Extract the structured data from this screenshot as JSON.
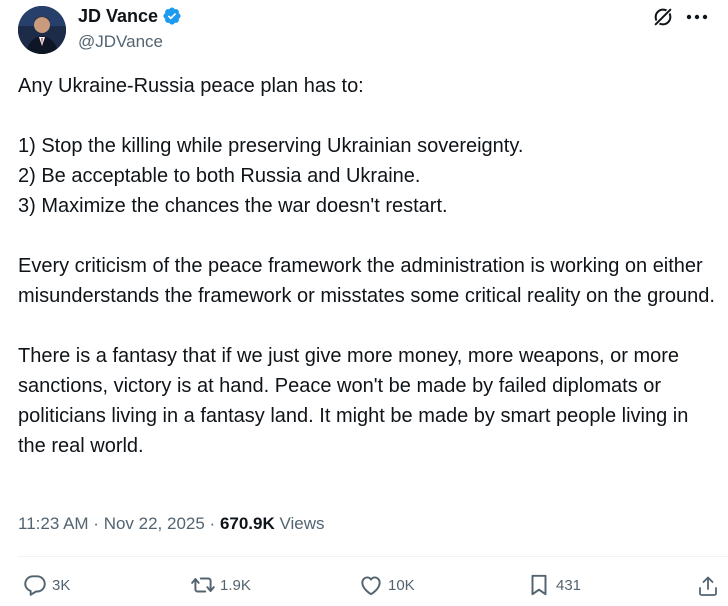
{
  "author": {
    "display_name": "JD Vance",
    "handle": "@JDVance"
  },
  "tweet": {
    "text": "Any Ukraine-Russia peace plan has to:\n\n1) Stop the killing while preserving Ukrainian sovereignty.\n2) Be acceptable to both Russia and Ukraine.\n3) Maximize the chances the war doesn't restart.\n\nEvery criticism of the peace framework the administration is working on either misunderstands the framework or misstates some critical reality on the ground.\n\nThere is a fantasy that if we just give more money, more weapons, or more sanctions, victory is at hand. Peace won't be made by failed diplomats or politicians living in a fantasy land. It might be made by smart people living in the real world."
  },
  "meta": {
    "time": "11:23 AM",
    "sep1": " · ",
    "date": "Nov 22, 2025",
    "sep2": " · ",
    "views_count": "670.9K",
    "views_label": " Views"
  },
  "actions": {
    "replies": "3K",
    "reposts": "1.9K",
    "likes": "10K",
    "bookmarks": "431"
  },
  "colors": {
    "verified": "#1d9bf0",
    "muted": "#536471",
    "text": "#0f1419"
  },
  "icons": {
    "verified": "verified-badge-icon",
    "grok": "grok-icon",
    "more": "more-options-icon",
    "reply": "reply-icon",
    "repost": "repost-icon",
    "like": "heart-icon",
    "bookmark": "bookmark-icon",
    "share": "share-icon"
  }
}
